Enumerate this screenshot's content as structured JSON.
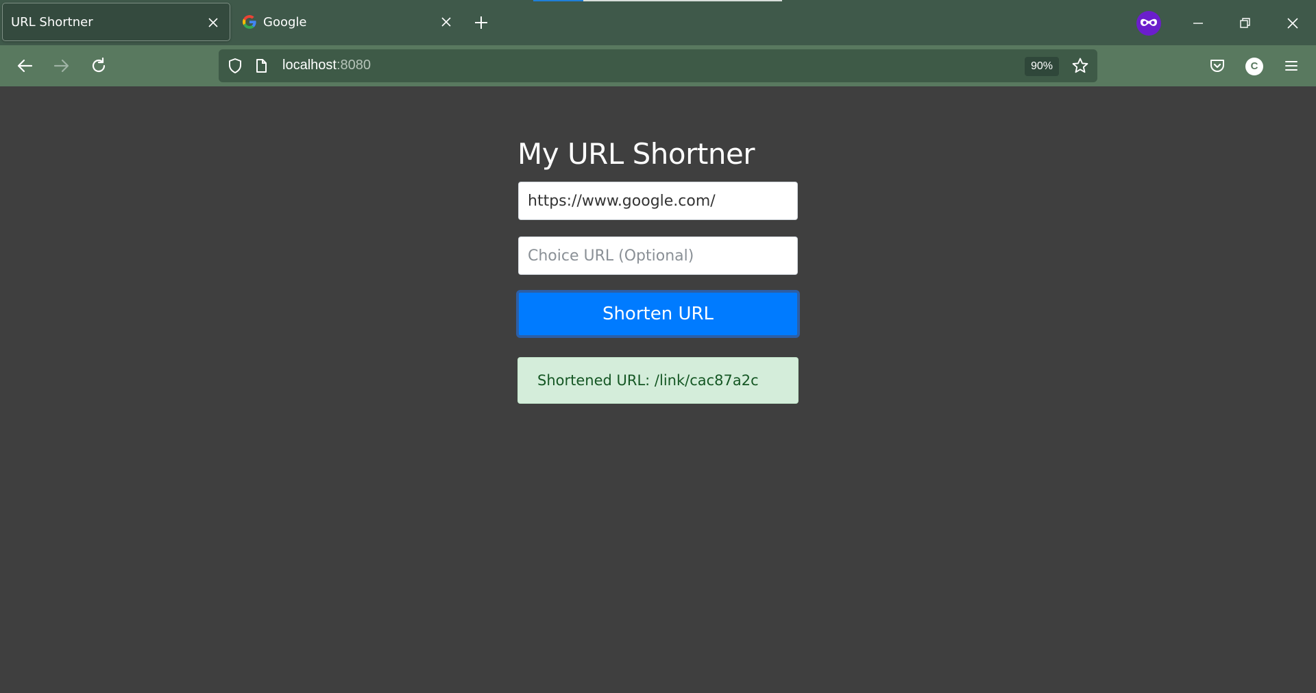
{
  "browser": {
    "tabs": [
      {
        "title": "URL Shortner",
        "active": true
      },
      {
        "title": "Google",
        "active": false
      }
    ],
    "url": {
      "host": "localhost",
      "port": ":8080"
    },
    "zoom": "90%",
    "profile_initial": "C",
    "colors": {
      "tabstrip": "#3f594a",
      "toolbar": "#59795f",
      "private_badge": "#6b1ecc"
    },
    "icons": [
      "back-icon",
      "forward-icon",
      "reload-icon",
      "shield-icon",
      "page-icon",
      "star-icon",
      "pocket-icon",
      "menu-icon",
      "close-icon",
      "plus-icon",
      "minimize-icon",
      "restore-icon",
      "private-browsing-icon",
      "google-icon"
    ]
  },
  "page": {
    "heading": "My URL Shortner",
    "url_input": {
      "value": "https://www.google.com/",
      "placeholder": ""
    },
    "choice_input": {
      "value": "",
      "placeholder": "Choice URL (Optional)"
    },
    "submit_label": "Shorten URL",
    "result_text": "Shortened URL: /link/cac87a2c",
    "colors": {
      "background": "#3f3f3f",
      "button": "#007bff",
      "success_bg": "#d4edda",
      "success_text": "#155724"
    }
  }
}
